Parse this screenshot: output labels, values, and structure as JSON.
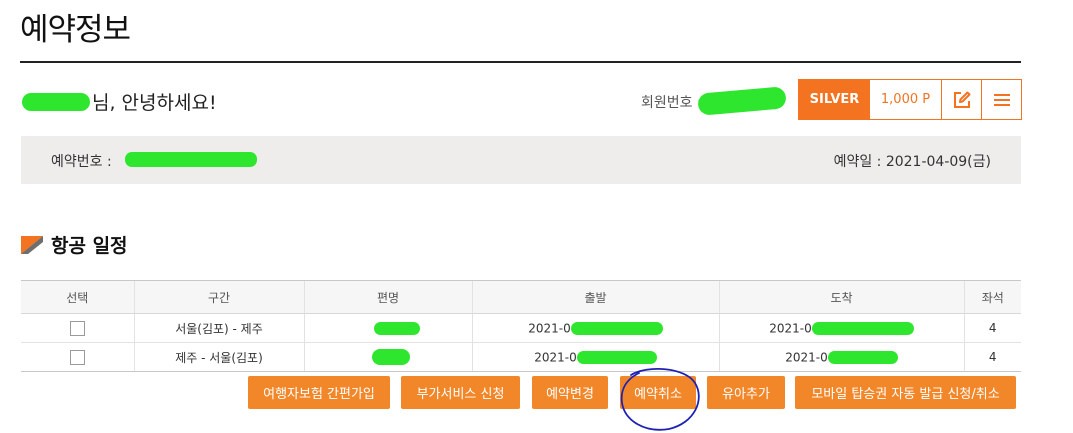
{
  "page": {
    "title": "예약정보"
  },
  "greeting": {
    "suffix": "님, 안녕하세요!"
  },
  "member": {
    "number_label": "회원번호 :",
    "grade": "SILVER",
    "points": "1,000 P",
    "edit_icon": "edit-icon",
    "menu_icon": "menu-icon"
  },
  "reservation": {
    "number_label": "예약번호 :",
    "date_text": "예약일 : 2021-04-09(금)"
  },
  "section": {
    "title": "항공 일정",
    "icon": "orange-flag-icon"
  },
  "table": {
    "headers": [
      "선택",
      "구간",
      "편명",
      "출발",
      "도착",
      "좌석"
    ],
    "rows": [
      {
        "route": "서울(김포) - 제주",
        "depart_prefix": "2021-0",
        "arrive_prefix": "2021-0",
        "seats": "4"
      },
      {
        "route": "제주 - 서울(김포)",
        "depart_prefix": "2021-0",
        "arrive_prefix": "2021-0",
        "seats": "4"
      }
    ]
  },
  "buttons": {
    "insurance": "여행자보험 간편가입",
    "extra_service": "부가서비스 신청",
    "change": "예약변경",
    "cancel": "예약취소",
    "add_infant": "유아추가",
    "mobile_pass": "모바일 탑승권 자동 발급 신청/취소"
  },
  "colors": {
    "accent": "#f37321",
    "button": "#f2872a",
    "annotation": "#1d22b5",
    "mask": "#2ee62e"
  }
}
